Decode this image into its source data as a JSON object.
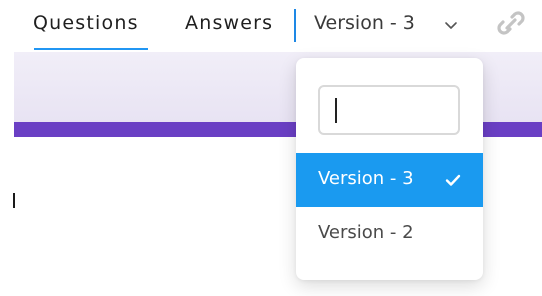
{
  "tabs": [
    {
      "label": "Questions",
      "active": true
    },
    {
      "label": "Answers",
      "active": false
    }
  ],
  "version_select": {
    "current": "Version - 3",
    "chevron_icon": "chevron-down-icon",
    "link_icon": "link-icon"
  },
  "dropdown": {
    "search_value": "",
    "options": [
      {
        "label": "Version - 3",
        "selected": true,
        "icon": "check-icon"
      },
      {
        "label": "Version - 2",
        "selected": false
      }
    ]
  },
  "colors": {
    "accent": "#2196f3",
    "selected_option": "#1a9af0",
    "banner_stripe": "#6a3fc4",
    "banner_bg": "#ede9f6"
  }
}
